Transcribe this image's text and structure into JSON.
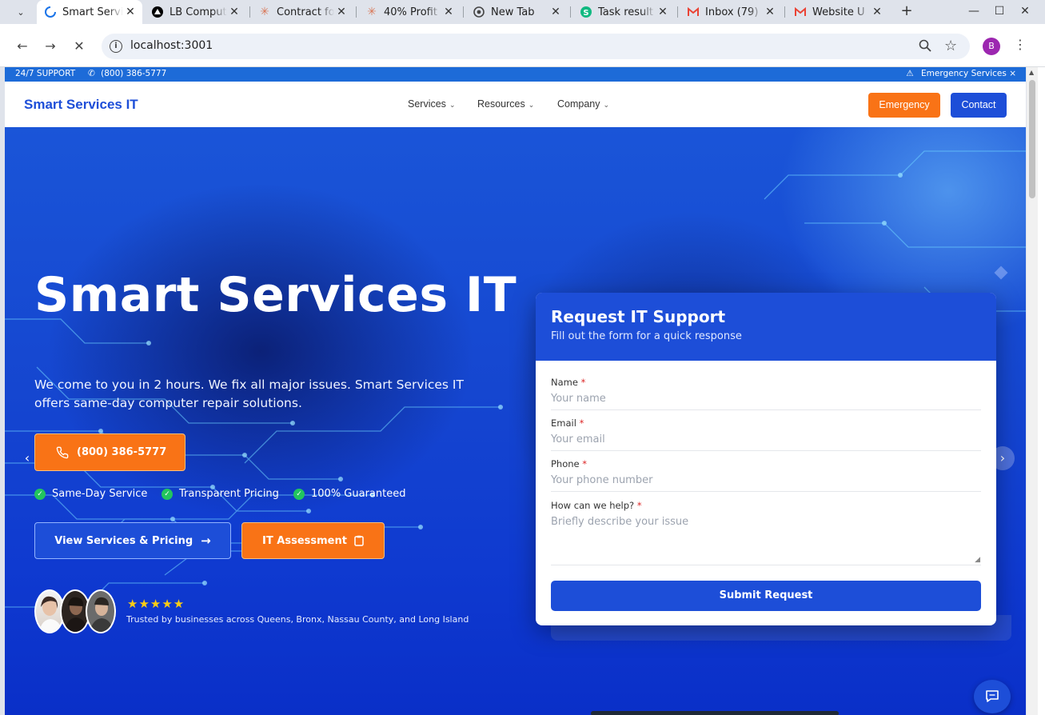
{
  "browser": {
    "tabs": [
      {
        "title": "Smart Services IT",
        "active": true,
        "favicon": "loading-spinner-icon"
      },
      {
        "title": "LB Computer",
        "active": false,
        "favicon": "vercel-icon"
      },
      {
        "title": "Contract for",
        "active": false,
        "favicon": "claude-icon"
      },
      {
        "title": "40% Profit",
        "active": false,
        "favicon": "claude-icon"
      },
      {
        "title": "New Tab",
        "active": false,
        "favicon": "chrome-icon"
      },
      {
        "title": "Task result",
        "active": false,
        "favicon": "s-icon"
      },
      {
        "title": "Inbox (79)",
        "active": false,
        "favicon": "gmail-icon"
      },
      {
        "title": "Website U",
        "active": false,
        "favicon": "gmail-icon"
      }
    ],
    "url": "localhost:3001",
    "profile_initial": "B"
  },
  "topbar": {
    "support_label": "24/7 SUPPORT",
    "phone": "(800) 386-5777",
    "emergency_label": "Emergency Services ×"
  },
  "nav": {
    "brand": "Smart Services IT",
    "menu": [
      "Services",
      "Resources",
      "Company"
    ],
    "emergency_button": "Emergency",
    "contact_button": "Contact"
  },
  "hero": {
    "title": "Smart Services IT",
    "description": "We come to you in 2 hours. We fix all major issues. Smart Services IT offers same-day computer repair solutions.",
    "phone_button": "(800) 386-5777",
    "features": [
      "Same-Day Service",
      "Transparent Pricing",
      "100% Guaranteed"
    ],
    "view_services_button": "View Services & Pricing",
    "assessment_button": "IT Assessment",
    "rating_stars": "★★★★★",
    "trust_text": "Trusted by businesses across Queens, Bronx, Nassau County, and Long Island"
  },
  "form": {
    "title": "Request IT Support",
    "subtitle": "Fill out the form for a quick response",
    "fields": [
      {
        "label": "Name",
        "required": "*",
        "placeholder": "Your name"
      },
      {
        "label": "Email",
        "required": "*",
        "placeholder": "Your email"
      },
      {
        "label": "Phone",
        "required": "*",
        "placeholder": "Your phone number"
      },
      {
        "label": "How can we help?",
        "required": "*",
        "placeholder": "Briefly describe your issue"
      }
    ],
    "submit_button": "Submit Request"
  },
  "colors": {
    "primary": "#1d4ed8",
    "accent": "#f97316",
    "check": "#22c55e",
    "star": "#facc15"
  }
}
